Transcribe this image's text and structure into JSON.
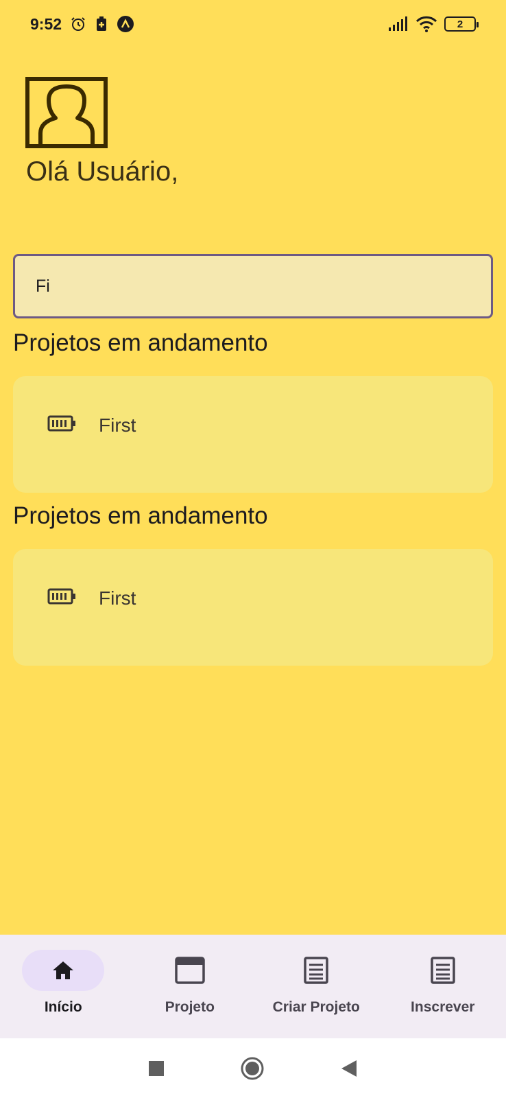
{
  "status_bar": {
    "time": "9:52",
    "battery_level": "2",
    "icons": [
      "alarm-icon",
      "battery-saver-icon",
      "app-notification-icon",
      "signal-icon",
      "wifi-icon",
      "battery-icon"
    ]
  },
  "header": {
    "avatar_icon": "person-silhouette-icon",
    "greeting": "Olá Usuário,"
  },
  "search": {
    "value": "Fi",
    "placeholder": ""
  },
  "sections": [
    {
      "title": "Projetos em andamento",
      "card": {
        "icon": "battery-icon",
        "title": "First"
      }
    },
    {
      "title": "Projetos em andamento",
      "card": {
        "icon": "battery-icon",
        "title": "First"
      }
    }
  ],
  "bottom_nav": {
    "items": [
      {
        "label": "Início",
        "icon": "home-icon",
        "active": true
      },
      {
        "label": "Projeto",
        "icon": "window-icon",
        "active": false
      },
      {
        "label": "Criar Projeto",
        "icon": "document-icon",
        "active": false
      },
      {
        "label": "Inscrever",
        "icon": "document-icon",
        "active": false
      }
    ]
  },
  "colors": {
    "background": "#FFDE59",
    "card": "#F7E67A",
    "search_bg": "#F5E8B0",
    "search_border": "#6D5A84",
    "nav_bg": "#F2ECF4",
    "nav_active_pill": "#E8DEF8"
  }
}
